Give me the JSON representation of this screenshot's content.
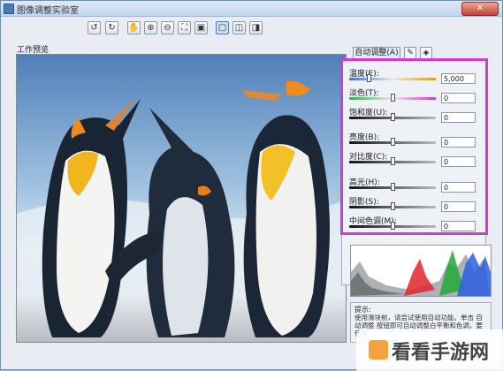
{
  "window": {
    "title": "图像调整实验室",
    "close_label": "✕"
  },
  "toolbar": {
    "buttons": [
      {
        "name": "rotate-left-icon",
        "glyph": "↺"
      },
      {
        "name": "rotate-right-icon",
        "glyph": "↻"
      },
      {
        "name": "hand-tool-icon",
        "glyph": "✋"
      },
      {
        "name": "zoom-in-icon",
        "glyph": "⊕"
      },
      {
        "name": "zoom-out-icon",
        "glyph": "⊖"
      },
      {
        "name": "fit-screen-icon",
        "glyph": "⛶"
      },
      {
        "name": "actual-size-icon",
        "glyph": "▣"
      },
      {
        "name": "single-view-icon",
        "glyph": "▢"
      },
      {
        "name": "split-view-icon",
        "glyph": "◫"
      },
      {
        "name": "side-by-side-icon",
        "glyph": "◨"
      }
    ]
  },
  "preview": {
    "label": "工作预览"
  },
  "panel": {
    "auto_tab": "自动调整(A)",
    "tab2_icon": "eyedropper-icon",
    "tab3_icon": "color-picker-icon",
    "sliders": [
      {
        "label": "温度(E):",
        "value": "5,000",
        "position": 0.22,
        "track": "temperature"
      },
      {
        "label": "淡色(T):",
        "value": "0",
        "position": 0.5,
        "track": "tint"
      },
      {
        "label": "饱和度(U):",
        "value": "0",
        "position": 0.5,
        "track": "gray"
      },
      {
        "label": "亮度(B):",
        "value": "0",
        "position": 0.5,
        "track": "gray"
      },
      {
        "label": "对比度(C):",
        "value": "0",
        "position": 0.5,
        "track": "gray"
      },
      {
        "label": "高光(H):",
        "value": "0",
        "position": 0.5,
        "track": "gray"
      },
      {
        "label": "阴影(S):",
        "value": "0",
        "position": 0.5,
        "track": "gray"
      },
      {
        "label": "中间色调(M):",
        "value": "0",
        "position": 0.5,
        "track": "gray"
      }
    ]
  },
  "tips": {
    "title": "提示:",
    "text": "使用滑块前，请尝试使用自动功能。单击 自动调整 按钮即可自动调整白平衡和色调，要使用"
  },
  "watermark": {
    "text": "看看手游网"
  },
  "colors": {
    "highlight": "#d23bcf",
    "accent": "#4f7cb3"
  }
}
